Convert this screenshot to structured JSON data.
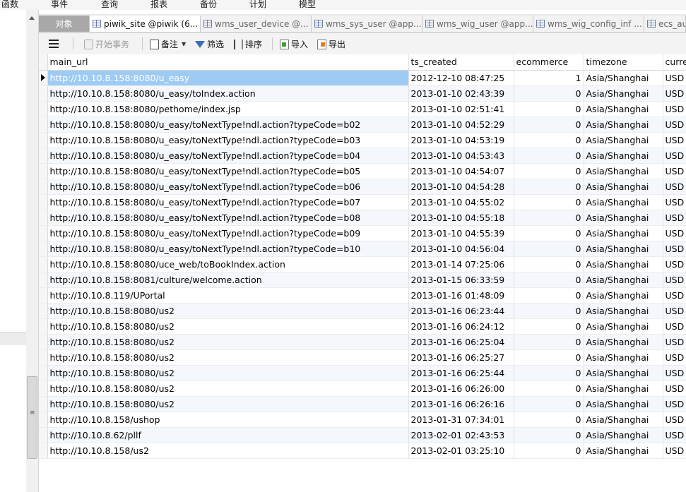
{
  "menu": [
    "函数",
    "事件",
    "查询",
    "报表",
    "备份",
    "计划",
    "模型"
  ],
  "tabs": [
    {
      "label": "对象",
      "kind": "objects"
    },
    {
      "label": "piwik_site @piwik (6...",
      "kind": "active"
    },
    {
      "label": "wms_user_device @...",
      "kind": "normal"
    },
    {
      "label": "wms_sys_user @app...",
      "kind": "normal"
    },
    {
      "label": "wms_wig_user @app...",
      "kind": "normal"
    },
    {
      "label": "wms_wig_config_inf ...",
      "kind": "normal"
    },
    {
      "label": "ecs_au",
      "kind": "normal"
    }
  ],
  "toolbar": {
    "menu_icon": "hamburger-icon",
    "begin_transaction": "开始事务",
    "note": "备注",
    "filter": "筛选",
    "sort": "排序",
    "import": "导入",
    "export": "导出"
  },
  "table": {
    "columns": [
      "main_url",
      "ts_created",
      "ecommerce",
      "timezone",
      "curre"
    ],
    "rows": [
      [
        "http://10.10.8.158:8080/u_easy",
        "2012-12-10 08:47:25",
        "1",
        "Asia/Shanghai",
        "USD"
      ],
      [
        "http://10.10.8.158:8080/u_easy/toIndex.action",
        "2013-01-10 02:43:39",
        "0",
        "Asia/Shanghai",
        "USD"
      ],
      [
        "http://10.10.8.158:8080/pethome/index.jsp",
        "2013-01-10 02:51:41",
        "0",
        "Asia/Shanghai",
        "USD"
      ],
      [
        "http://10.10.8.158:8080/u_easy/toNextType!ndl.action?typeCode=b02",
        "2013-01-10 04:52:29",
        "0",
        "Asia/Shanghai",
        "USD"
      ],
      [
        "http://10.10.8.158:8080/u_easy/toNextType!ndl.action?typeCode=b03",
        "2013-01-10 04:53:19",
        "0",
        "Asia/Shanghai",
        "USD"
      ],
      [
        "http://10.10.8.158:8080/u_easy/toNextType!ndl.action?typeCode=b04",
        "2013-01-10 04:53:43",
        "0",
        "Asia/Shanghai",
        "USD"
      ],
      [
        "http://10.10.8.158:8080/u_easy/toNextType!ndl.action?typeCode=b05",
        "2013-01-10 04:54:07",
        "0",
        "Asia/Shanghai",
        "USD"
      ],
      [
        "http://10.10.8.158:8080/u_easy/toNextType!ndl.action?typeCode=b06",
        "2013-01-10 04:54:28",
        "0",
        "Asia/Shanghai",
        "USD"
      ],
      [
        "http://10.10.8.158:8080/u_easy/toNextType!ndl.action?typeCode=b07",
        "2013-01-10 04:55:02",
        "0",
        "Asia/Shanghai",
        "USD"
      ],
      [
        "http://10.10.8.158:8080/u_easy/toNextType!ndl.action?typeCode=b08",
        "2013-01-10 04:55:18",
        "0",
        "Asia/Shanghai",
        "USD"
      ],
      [
        "http://10.10.8.158:8080/u_easy/toNextType!ndl.action?typeCode=b09",
        "2013-01-10 04:55:39",
        "0",
        "Asia/Shanghai",
        "USD"
      ],
      [
        "http://10.10.8.158:8080/u_easy/toNextType!ndl.action?typeCode=b10",
        "2013-01-10 04:56:04",
        "0",
        "Asia/Shanghai",
        "USD"
      ],
      [
        "http://10.10.8.158:8080/uce_web/toBookIndex.action",
        "2013-01-14 07:25:06",
        "0",
        "Asia/Shanghai",
        "USD"
      ],
      [
        "http://10.10.8.158:8081/culture/welcome.action",
        "2013-01-15 06:33:59",
        "0",
        "Asia/Shanghai",
        "USD"
      ],
      [
        "http://10.10.8.119/UPortal",
        "2013-01-16 01:48:09",
        "0",
        "Asia/Shanghai",
        "USD"
      ],
      [
        "http://10.10.8.158:8080/us2",
        "2013-01-16 06:23:44",
        "0",
        "Asia/Shanghai",
        "USD"
      ],
      [
        "http://10.10.8.158:8080/us2",
        "2013-01-16 06:24:12",
        "0",
        "Asia/Shanghai",
        "USD"
      ],
      [
        "http://10.10.8.158:8080/us2",
        "2013-01-16 06:25:04",
        "0",
        "Asia/Shanghai",
        "USD"
      ],
      [
        "http://10.10.8.158:8080/us2",
        "2013-01-16 06:25:27",
        "0",
        "Asia/Shanghai",
        "USD"
      ],
      [
        "http://10.10.8.158:8080/us2",
        "2013-01-16 06:25:44",
        "0",
        "Asia/Shanghai",
        "USD"
      ],
      [
        "http://10.10.8.158:8080/us2",
        "2013-01-16 06:26:00",
        "0",
        "Asia/Shanghai",
        "USD"
      ],
      [
        "http://10.10.8.158:8080/us2",
        "2013-01-16 06:26:16",
        "0",
        "Asia/Shanghai",
        "USD"
      ],
      [
        "http://10.10.8.158/ushop",
        "2013-01-31 07:34:01",
        "0",
        "Asia/Shanghai",
        "USD"
      ],
      [
        "http://10.10.8.62/pllf",
        "2013-02-01 02:43:53",
        "0",
        "Asia/Shanghai",
        "USD"
      ],
      [
        "http://10.10.8.158/us2",
        "2013-02-01 03:25:10",
        "0",
        "Asia/Shanghai",
        "USD"
      ]
    ],
    "selected_row": 0
  }
}
